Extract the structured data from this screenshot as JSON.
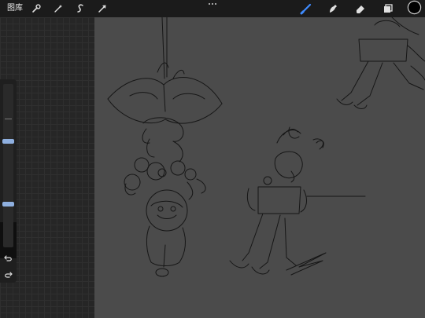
{
  "topbar": {
    "gallery_label": "图库",
    "left_tools": [
      {
        "name": "actions",
        "icon": "wrench-icon"
      },
      {
        "name": "adjustments",
        "icon": "magic-wand-icon"
      },
      {
        "name": "selection",
        "icon": "selection-s-icon"
      },
      {
        "name": "transform",
        "icon": "arrow-cursor-icon"
      }
    ],
    "right_tools": [
      {
        "name": "brush",
        "icon": "brush-icon",
        "active": true
      },
      {
        "name": "smudge",
        "icon": "smudge-icon",
        "active": false
      },
      {
        "name": "eraser",
        "icon": "eraser-icon",
        "active": false
      },
      {
        "name": "layers",
        "icon": "layers-icon",
        "active": false
      }
    ],
    "current_color": "#000000"
  },
  "sidebar": {
    "brush_size_level": 0.55,
    "opacity_level": 0.8,
    "undo_icon": "undo-icon",
    "redo_icon": "redo-icon"
  },
  "colors": {
    "accent": "#3f8cff",
    "canvas": "#4b4b4b",
    "toolbar": "#1b1b1b"
  }
}
